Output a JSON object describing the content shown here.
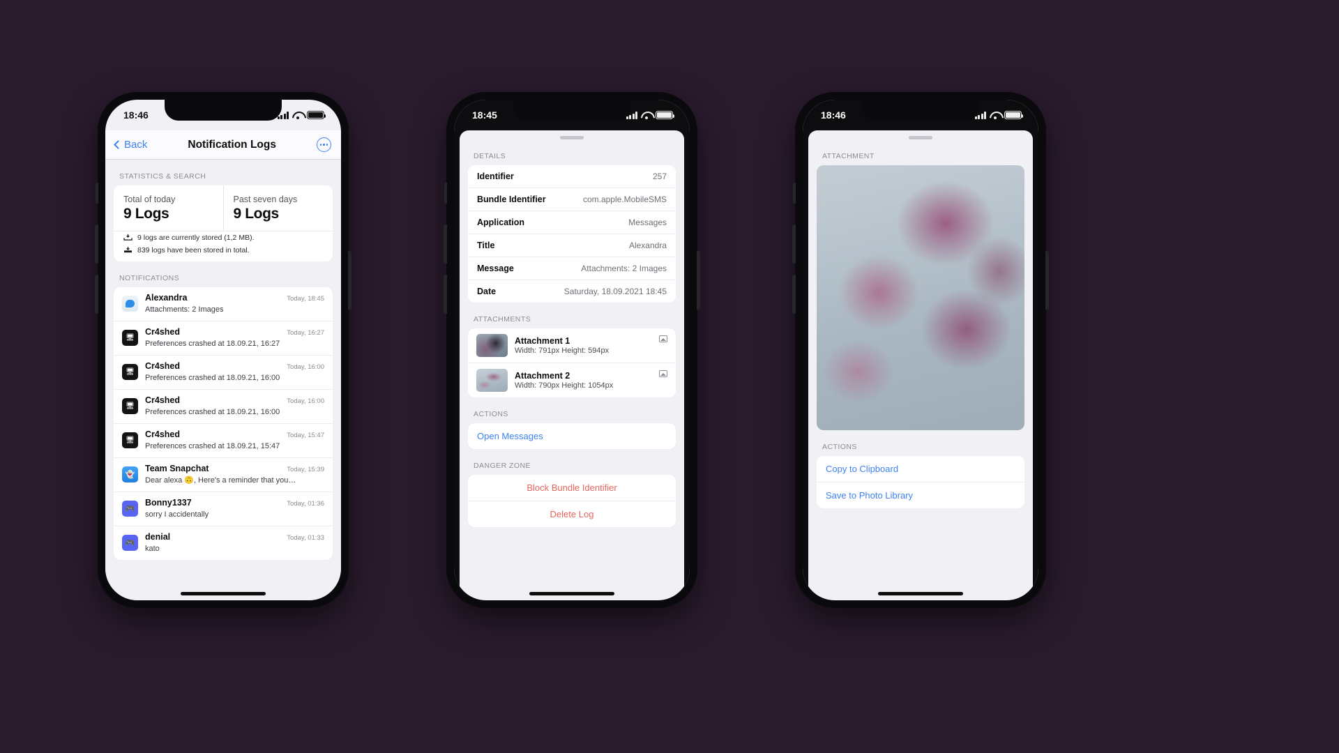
{
  "theme": {
    "background": "#2a1b2d",
    "accent": "#3b82f6",
    "danger": "#e8645c"
  },
  "phone1": {
    "status": {
      "time": "18:46"
    },
    "nav": {
      "back_label": "Back",
      "title": "Notification Logs",
      "more_label": "More"
    },
    "statistics": {
      "section_header": "STATISTICS & SEARCH",
      "cards": [
        {
          "label": "Total of today",
          "value": "9 Logs"
        },
        {
          "label": "Past seven days",
          "value": "9 Logs"
        }
      ],
      "storage_lines": [
        "9 logs are currently stored (1,2 MB).",
        "839 logs have been stored in total."
      ]
    },
    "notifications": {
      "section_header": "NOTIFICATIONS",
      "items": [
        {
          "icon": "messages-icon",
          "title": "Alexandra",
          "subtitle": "Attachments: 2 Images",
          "time": "Today, 18:45"
        },
        {
          "icon": "cr4shed-icon",
          "title": "Cr4shed",
          "subtitle": "Preferences crashed at 18.09.21, 16:27",
          "time": "Today, 16:27"
        },
        {
          "icon": "cr4shed-icon",
          "title": "Cr4shed",
          "subtitle": "Preferences crashed at 18.09.21, 16:00",
          "time": "Today, 16:00"
        },
        {
          "icon": "cr4shed-icon",
          "title": "Cr4shed",
          "subtitle": "Preferences crashed at 18.09.21, 16:00",
          "time": "Today, 16:00"
        },
        {
          "icon": "cr4shed-icon",
          "title": "Cr4shed",
          "subtitle": "Preferences crashed at 18.09.21, 15:47",
          "time": "Today, 15:47"
        },
        {
          "icon": "snapchat-icon",
          "title": "Team Snapchat",
          "subtitle": "Dear alexa 🙃, Here's a reminder that you…",
          "time": "Today, 15:39"
        },
        {
          "icon": "discord-icon",
          "title": "Bonny1337",
          "subtitle": "sorry I accidentally",
          "time": "Today, 01:36"
        },
        {
          "icon": "discord-icon",
          "title": "denial",
          "subtitle": "kato",
          "time": "Today, 01:33"
        }
      ]
    }
  },
  "phone2": {
    "status": {
      "time": "18:45"
    },
    "details": {
      "section_header": "DETAILS",
      "rows": [
        {
          "key": "Identifier",
          "value": "257"
        },
        {
          "key": "Bundle Identifier",
          "value": "com.apple.MobileSMS"
        },
        {
          "key": "Application",
          "value": "Messages"
        },
        {
          "key": "Title",
          "value": "Alexandra"
        },
        {
          "key": "Message",
          "value": "Attachments: 2 Images"
        },
        {
          "key": "Date",
          "value": "Saturday, 18.09.2021 18:45"
        }
      ]
    },
    "attachments": {
      "section_header": "ATTACHMENTS",
      "items": [
        {
          "name": "Attachment 1",
          "dimensions": "Width: 791px Height: 594px",
          "thumb": "bird-photo"
        },
        {
          "name": "Attachment 2",
          "dimensions": "Width: 790px Height: 1054px",
          "thumb": "blossom-photo"
        }
      ]
    },
    "actions": {
      "section_header": "ACTIONS",
      "items": [
        {
          "label": "Open Messages"
        }
      ]
    },
    "danger_zone": {
      "section_header": "DANGER ZONE",
      "items": [
        {
          "label": "Block Bundle Identifier"
        },
        {
          "label": "Delete Log"
        }
      ]
    }
  },
  "phone3": {
    "status": {
      "time": "18:46"
    },
    "attachment": {
      "section_header": "ATTACHMENT",
      "image_alt": "blossom-photo"
    },
    "actions": {
      "section_header": "ACTIONS",
      "items": [
        {
          "label": "Copy to Clipboard"
        },
        {
          "label": "Save to Photo Library"
        }
      ]
    }
  }
}
